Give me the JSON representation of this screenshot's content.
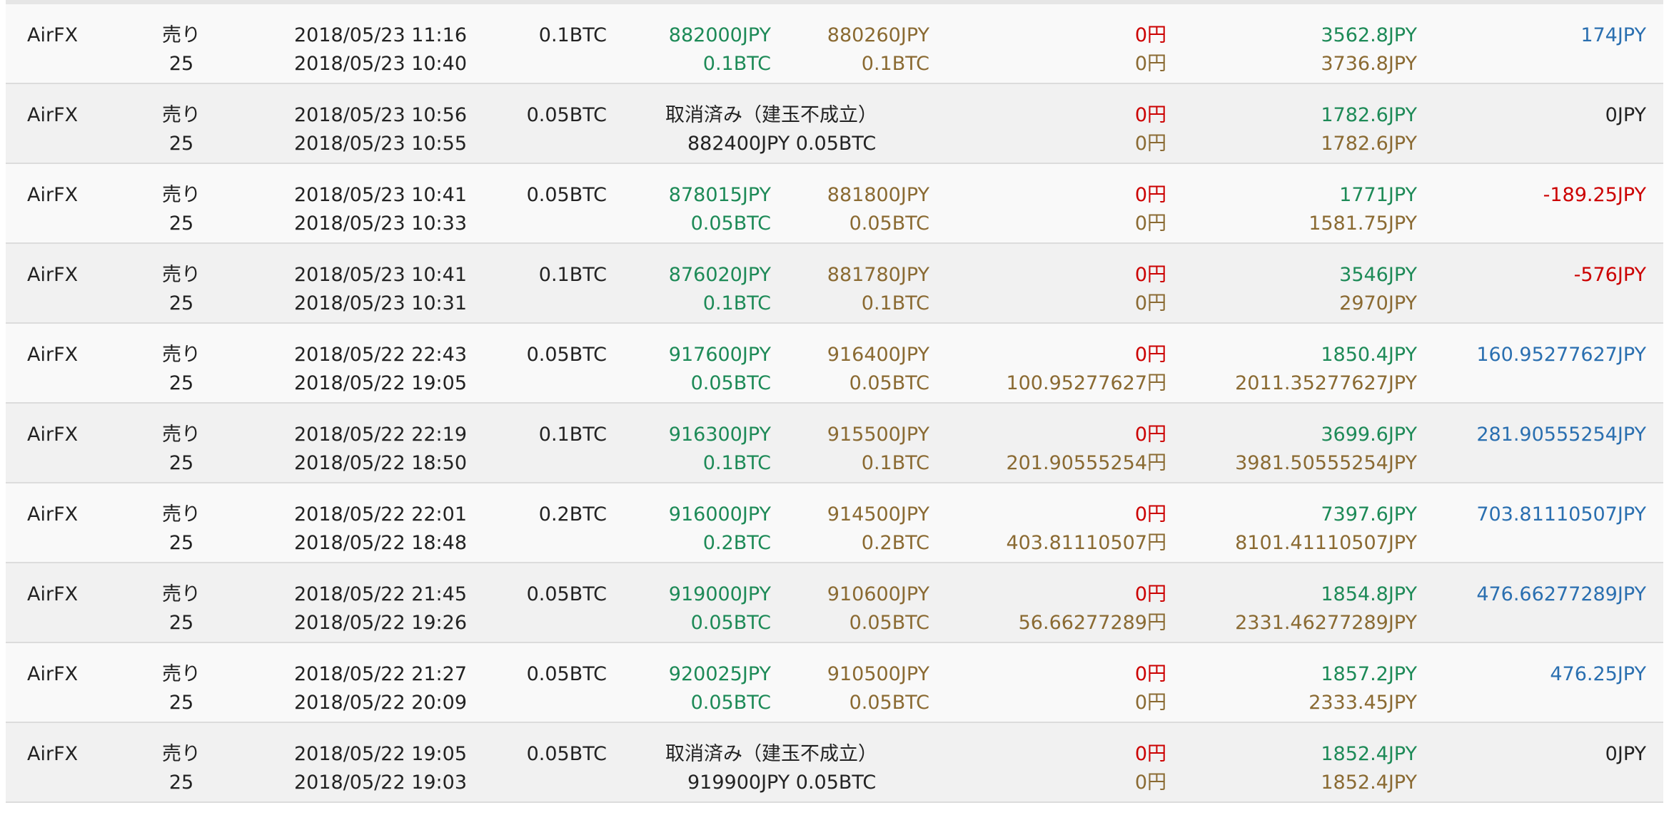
{
  "colors": {
    "green": "#1d8a57",
    "brown": "#8a6a32",
    "red": "#cc0000",
    "blue": "#2a6fb0"
  },
  "rows": [
    {
      "exchange": "AirFX",
      "side": "売り",
      "leverage": "25",
      "close_time": "2018/05/23 11:16",
      "open_time": "2018/05/23 10:40",
      "qty": "0.1BTC",
      "close_price": "882000JPY",
      "close_qty": "0.1BTC",
      "open_price": "880260JPY",
      "open_qty": "0.1BTC",
      "cancelled": false,
      "fee": "0円",
      "swap": "0円",
      "margin_top": "3562.8JPY",
      "margin_bottom": "3736.8JPY",
      "pnl": "174JPY",
      "pnl_color": "blue"
    },
    {
      "exchange": "AirFX",
      "side": "売り",
      "leverage": "25",
      "close_time": "2018/05/23 10:56",
      "open_time": "2018/05/23 10:55",
      "qty": "0.05BTC",
      "cancelled": true,
      "cancel_label": "取消済み（建玉不成立）",
      "cancel_detail": "882400JPY 0.05BTC",
      "fee": "0円",
      "swap": "0円",
      "margin_top": "1782.6JPY",
      "margin_bottom": "1782.6JPY",
      "pnl": "0JPY",
      "pnl_color": "dark"
    },
    {
      "exchange": "AirFX",
      "side": "売り",
      "leverage": "25",
      "close_time": "2018/05/23 10:41",
      "open_time": "2018/05/23 10:33",
      "qty": "0.05BTC",
      "close_price": "878015JPY",
      "close_qty": "0.05BTC",
      "open_price": "881800JPY",
      "open_qty": "0.05BTC",
      "cancelled": false,
      "fee": "0円",
      "swap": "0円",
      "margin_top": "1771JPY",
      "margin_bottom": "1581.75JPY",
      "pnl": "-189.25JPY",
      "pnl_color": "red"
    },
    {
      "exchange": "AirFX",
      "side": "売り",
      "leverage": "25",
      "close_time": "2018/05/23 10:41",
      "open_time": "2018/05/23 10:31",
      "qty": "0.1BTC",
      "close_price": "876020JPY",
      "close_qty": "0.1BTC",
      "open_price": "881780JPY",
      "open_qty": "0.1BTC",
      "cancelled": false,
      "fee": "0円",
      "swap": "0円",
      "margin_top": "3546JPY",
      "margin_bottom": "2970JPY",
      "pnl": "-576JPY",
      "pnl_color": "red"
    },
    {
      "exchange": "AirFX",
      "side": "売り",
      "leverage": "25",
      "close_time": "2018/05/22 22:43",
      "open_time": "2018/05/22 19:05",
      "qty": "0.05BTC",
      "close_price": "917600JPY",
      "close_qty": "0.05BTC",
      "open_price": "916400JPY",
      "open_qty": "0.05BTC",
      "cancelled": false,
      "fee": "0円",
      "swap": "100.95277627円",
      "margin_top": "1850.4JPY",
      "margin_bottom": "2011.35277627JPY",
      "pnl": "160.95277627JPY",
      "pnl_color": "blue"
    },
    {
      "exchange": "AirFX",
      "side": "売り",
      "leverage": "25",
      "close_time": "2018/05/22 22:19",
      "open_time": "2018/05/22 18:50",
      "qty": "0.1BTC",
      "close_price": "916300JPY",
      "close_qty": "0.1BTC",
      "open_price": "915500JPY",
      "open_qty": "0.1BTC",
      "cancelled": false,
      "fee": "0円",
      "swap": "201.90555254円",
      "margin_top": "3699.6JPY",
      "margin_bottom": "3981.50555254JPY",
      "pnl": "281.90555254JPY",
      "pnl_color": "blue"
    },
    {
      "exchange": "AirFX",
      "side": "売り",
      "leverage": "25",
      "close_time": "2018/05/22 22:01",
      "open_time": "2018/05/22 18:48",
      "qty": "0.2BTC",
      "close_price": "916000JPY",
      "close_qty": "0.2BTC",
      "open_price": "914500JPY",
      "open_qty": "0.2BTC",
      "cancelled": false,
      "fee": "0円",
      "swap": "403.81110507円",
      "margin_top": "7397.6JPY",
      "margin_bottom": "8101.41110507JPY",
      "pnl": "703.81110507JPY",
      "pnl_color": "blue"
    },
    {
      "exchange": "AirFX",
      "side": "売り",
      "leverage": "25",
      "close_time": "2018/05/22 21:45",
      "open_time": "2018/05/22 19:26",
      "qty": "0.05BTC",
      "close_price": "919000JPY",
      "close_qty": "0.05BTC",
      "open_price": "910600JPY",
      "open_qty": "0.05BTC",
      "cancelled": false,
      "fee": "0円",
      "swap": "56.66277289円",
      "margin_top": "1854.8JPY",
      "margin_bottom": "2331.46277289JPY",
      "pnl": "476.66277289JPY",
      "pnl_color": "blue"
    },
    {
      "exchange": "AirFX",
      "side": "売り",
      "leverage": "25",
      "close_time": "2018/05/22 21:27",
      "open_time": "2018/05/22 20:09",
      "qty": "0.05BTC",
      "close_price": "920025JPY",
      "close_qty": "0.05BTC",
      "open_price": "910500JPY",
      "open_qty": "0.05BTC",
      "cancelled": false,
      "fee": "0円",
      "swap": "0円",
      "margin_top": "1857.2JPY",
      "margin_bottom": "2333.45JPY",
      "pnl": "476.25JPY",
      "pnl_color": "blue"
    },
    {
      "exchange": "AirFX",
      "side": "売り",
      "leverage": "25",
      "close_time": "2018/05/22 19:05",
      "open_time": "2018/05/22 19:03",
      "qty": "0.05BTC",
      "cancelled": true,
      "cancel_label": "取消済み（建玉不成立）",
      "cancel_detail": "919900JPY 0.05BTC",
      "fee": "0円",
      "swap": "0円",
      "margin_top": "1852.4JPY",
      "margin_bottom": "1852.4JPY",
      "pnl": "0JPY",
      "pnl_color": "dark"
    }
  ]
}
